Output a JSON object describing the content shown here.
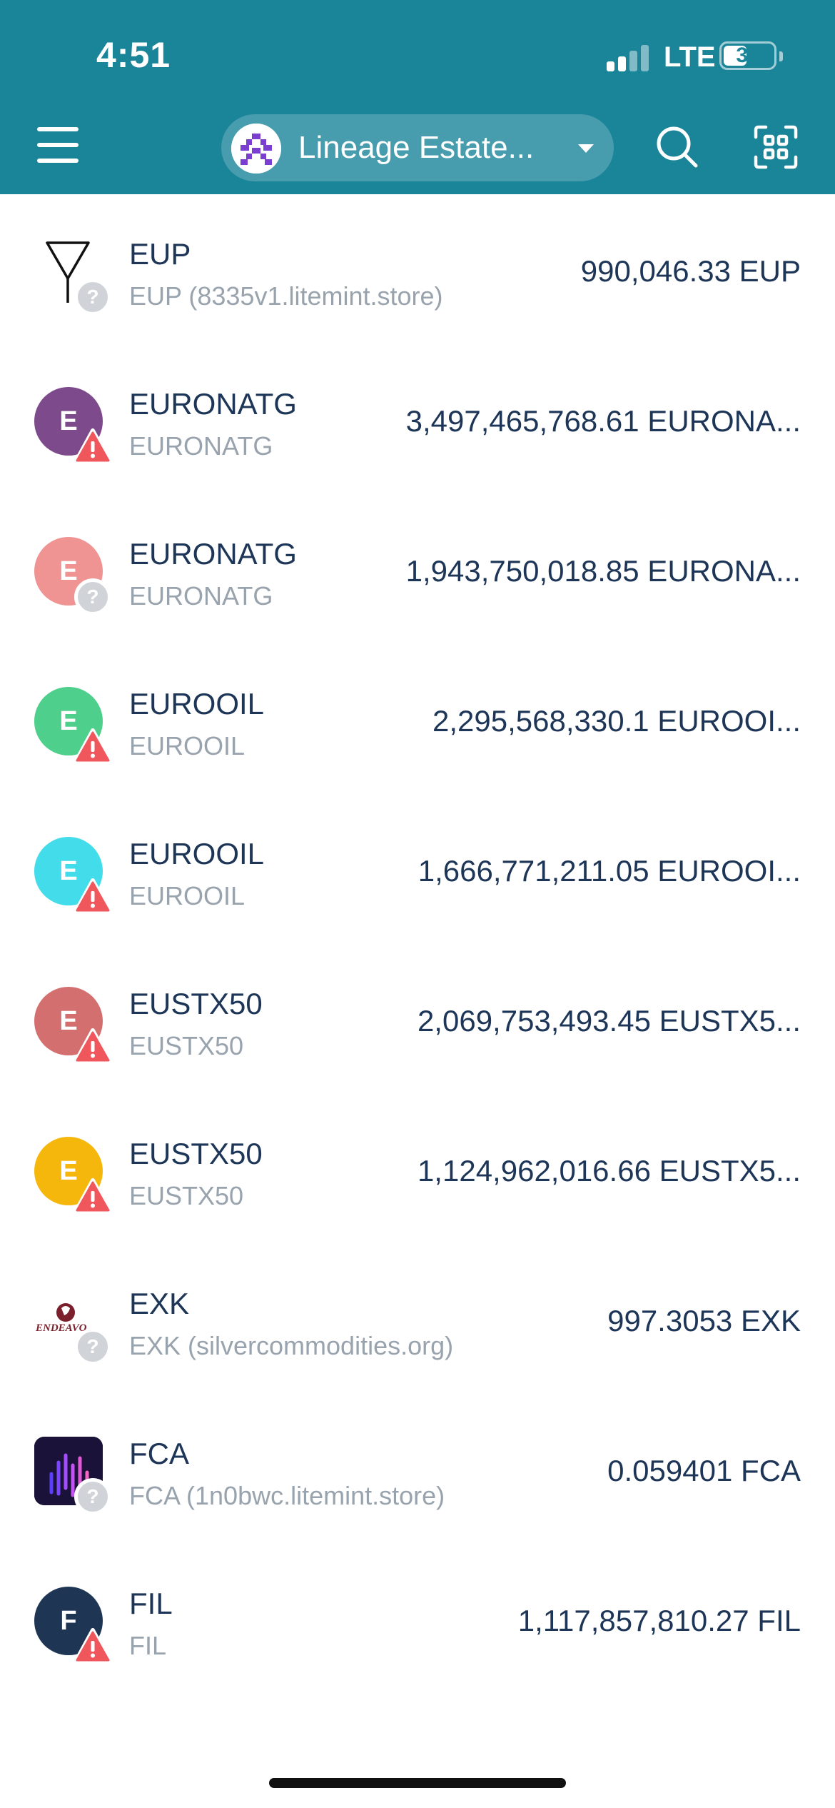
{
  "status_bar": {
    "time": "4:51",
    "network": "LTE",
    "battery": "35"
  },
  "header": {
    "account_name": "Lineage Estate...",
    "icons": {
      "menu": "hamburger-menu-icon",
      "search": "search-icon",
      "scan": "qr-scan-icon",
      "dropdown": "caret-down-icon"
    }
  },
  "colors": {
    "header_bg": "#1a8499",
    "text_primary": "#1d3557",
    "text_secondary": "#99a3ad",
    "warning": "#f0575c"
  },
  "tokens": [
    {
      "symbol": "EUP",
      "name": "EUP (8335v1.litemint.store)",
      "balance": "990,046.33 EUP",
      "icon_letter": "",
      "icon_color": "#ffffff",
      "badge": "question"
    },
    {
      "symbol": "EURONATG",
      "name": "EURONATG",
      "balance": "3,497,465,768.61 EURONA...",
      "icon_letter": "E",
      "icon_color": "#7d4a8b",
      "badge": "warning"
    },
    {
      "symbol": "EURONATG",
      "name": "EURONATG",
      "balance": "1,943,750,018.85 EURONA...",
      "icon_letter": "E",
      "icon_color": "#ef9393",
      "badge": "question"
    },
    {
      "symbol": "EUROOIL",
      "name": "EUROOIL",
      "balance": "2,295,568,330.1 EUROOI...",
      "icon_letter": "E",
      "icon_color": "#4ecf8b",
      "badge": "warning"
    },
    {
      "symbol": "EUROOIL",
      "name": "EUROOIL",
      "balance": "1,666,771,211.05 EUROOI...",
      "icon_letter": "E",
      "icon_color": "#42dceb",
      "badge": "warning"
    },
    {
      "symbol": "EUSTX50",
      "name": "EUSTX50",
      "balance": "2,069,753,493.45 EUSTX5...",
      "icon_letter": "E",
      "icon_color": "#d46f6f",
      "badge": "warning"
    },
    {
      "symbol": "EUSTX50",
      "name": "EUSTX50",
      "balance": "1,124,962,016.66 EUSTX5...",
      "icon_letter": "E",
      "icon_color": "#f6b70d",
      "badge": "warning"
    },
    {
      "symbol": "EXK",
      "name": "EXK (silvercommodities.org)",
      "balance": "997.3053 EXK",
      "icon_letter": "",
      "icon_color": "#ffffff",
      "badge": "question",
      "logo_text": "ENDEAVO"
    },
    {
      "symbol": "FCA",
      "name": "FCA (1n0bwc.litemint.store)",
      "balance": "0.059401 FCA",
      "icon_letter": "",
      "icon_color": "#1a1238",
      "badge": "question"
    },
    {
      "symbol": "FIL",
      "name": "FIL",
      "balance": "1,117,857,810.27 FIL",
      "icon_letter": "F",
      "icon_color": "#1f3554",
      "badge": "warning"
    }
  ]
}
